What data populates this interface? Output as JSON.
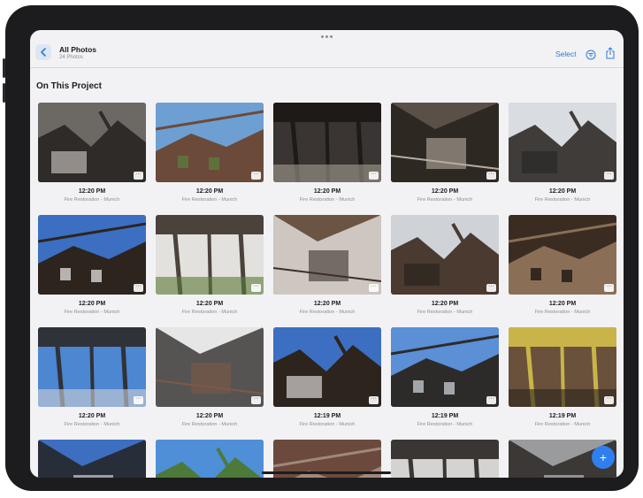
{
  "nav": {
    "title": "All Photos",
    "subtitle": "24 Photos",
    "select_label": "Select"
  },
  "section": {
    "title": "On This Project"
  },
  "photos": [
    {
      "time": "12:20 PM",
      "project": "Fire Restoration - Munich",
      "palette": [
        "#6c6864",
        "#2f2b28",
        "#bdb8b2"
      ]
    },
    {
      "time": "12:20 PM",
      "project": "Fire Restoration - Munich",
      "palette": [
        "#6e9fd3",
        "#6b4a3a",
        "#5d7b3c"
      ]
    },
    {
      "time": "12:20 PM",
      "project": "Fire Restoration - Munich",
      "palette": [
        "#3a3532",
        "#1e1a18",
        "#a59d93"
      ]
    },
    {
      "time": "12:20 PM",
      "project": "Fire Restoration - Munich",
      "palette": [
        "#5a5048",
        "#27211d",
        "#b7aea2"
      ]
    },
    {
      "time": "12:20 PM",
      "project": "Fire Restoration - Munich",
      "palette": [
        "#d9dde2",
        "#3f3c3a",
        "#2b2826"
      ]
    },
    {
      "time": "12:20 PM",
      "project": "Fire Restoration - Munich",
      "palette": [
        "#3c6fc2",
        "#2d241e",
        "#d8d6d3"
      ]
    },
    {
      "time": "12:20 PM",
      "project": "Fire Restoration - Munich",
      "palette": [
        "#e3e1dd",
        "#4b423c",
        "#5b7a38"
      ]
    },
    {
      "time": "12:20 PM",
      "project": "Fire Restoration - Munich",
      "palette": [
        "#6b5444",
        "#dedbd7",
        "#3a2f28"
      ]
    },
    {
      "time": "12:20 PM",
      "project": "Fire Restoration - Munich",
      "palette": [
        "#cfd3d8",
        "#4a3a30",
        "#2b241f"
      ]
    },
    {
      "time": "12:20 PM",
      "project": "Fire Restoration - Munich",
      "palette": [
        "#3b2c22",
        "#8a6f56",
        "#1d1712"
      ]
    },
    {
      "time": "12:20 PM",
      "project": "Fire Restoration - Munich",
      "palette": [
        "#4d86d1",
        "#2f3238",
        "#cfd1d3"
      ]
    },
    {
      "time": "12:20 PM",
      "project": "Fire Restoration - Munich",
      "palette": [
        "#e6e6e6",
        "#3c3a38",
        "#7c5a45"
      ]
    },
    {
      "time": "12:19 PM",
      "project": "Fire Restoration - Munich",
      "palette": [
        "#3c6fc2",
        "#2d241e",
        "#d8d6d3"
      ]
    },
    {
      "time": "12:19 PM",
      "project": "Fire Restoration - Munich",
      "palette": [
        "#5b8fd6",
        "#2d2b2a",
        "#bfc4c9"
      ]
    },
    {
      "time": "12:19 PM",
      "project": "Fire Restoration - Munich",
      "palette": [
        "#6a513c",
        "#c9b44a",
        "#2c231c"
      ]
    },
    {
      "time": "",
      "project": "",
      "palette": [
        "#3d6ec0",
        "#242222",
        "#e8e8e8"
      ]
    },
    {
      "time": "",
      "project": "",
      "palette": [
        "#4f8fd8",
        "#4d7a3a",
        "#e9eef2"
      ]
    },
    {
      "time": "",
      "project": "",
      "palette": [
        "#6b4a3d",
        "#a0887a",
        "#3a2c24"
      ]
    },
    {
      "time": "",
      "project": "",
      "palette": [
        "#d5d3cf",
        "#3a3634",
        "#7a6c60"
      ]
    },
    {
      "time": "",
      "project": "",
      "palette": [
        "#9a9b9c",
        "#2a2725",
        "#cfcfcd"
      ]
    }
  ],
  "fab_label": "+",
  "colors": {
    "accent": "#2b7bd8",
    "fab": "#2f7ff0"
  }
}
